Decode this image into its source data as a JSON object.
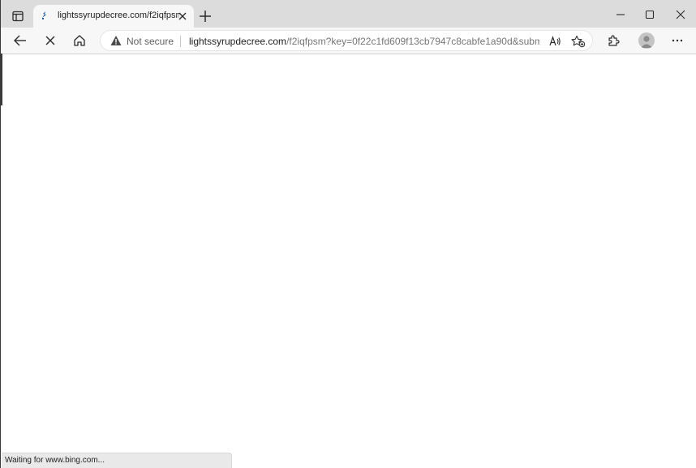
{
  "tab": {
    "title": "lightssyrupdecree.com/f2iqfpsm"
  },
  "addressbar": {
    "security_label": "Not secure",
    "url_host": "lightssyrupdecree.com",
    "url_path": "/f2iqfpsm?key=0f22c1fd609f13cb7947c8cabfe1a90d&subme..."
  },
  "status": {
    "text": "Waiting for www.bing.com..."
  },
  "icons": {
    "tab_actions": "tab-actions-icon",
    "favicon": "site-favicon",
    "tab_close": "close-icon",
    "new_tab": "plus-icon",
    "minimize": "minimize-icon",
    "maximize": "maximize-icon",
    "close_window": "close-icon",
    "back": "back-arrow-icon",
    "stop": "stop-icon",
    "home": "home-icon",
    "warning": "warning-icon",
    "read_aloud": "read-aloud-icon",
    "favorites": "add-favorite-icon",
    "extensions": "extensions-icon",
    "profile": "profile-avatar",
    "menu": "more-icon"
  },
  "colors": {
    "tabstrip": "#dcdcdc",
    "toolbar": "#f7f7f7",
    "favicon": "#1a5dab"
  }
}
